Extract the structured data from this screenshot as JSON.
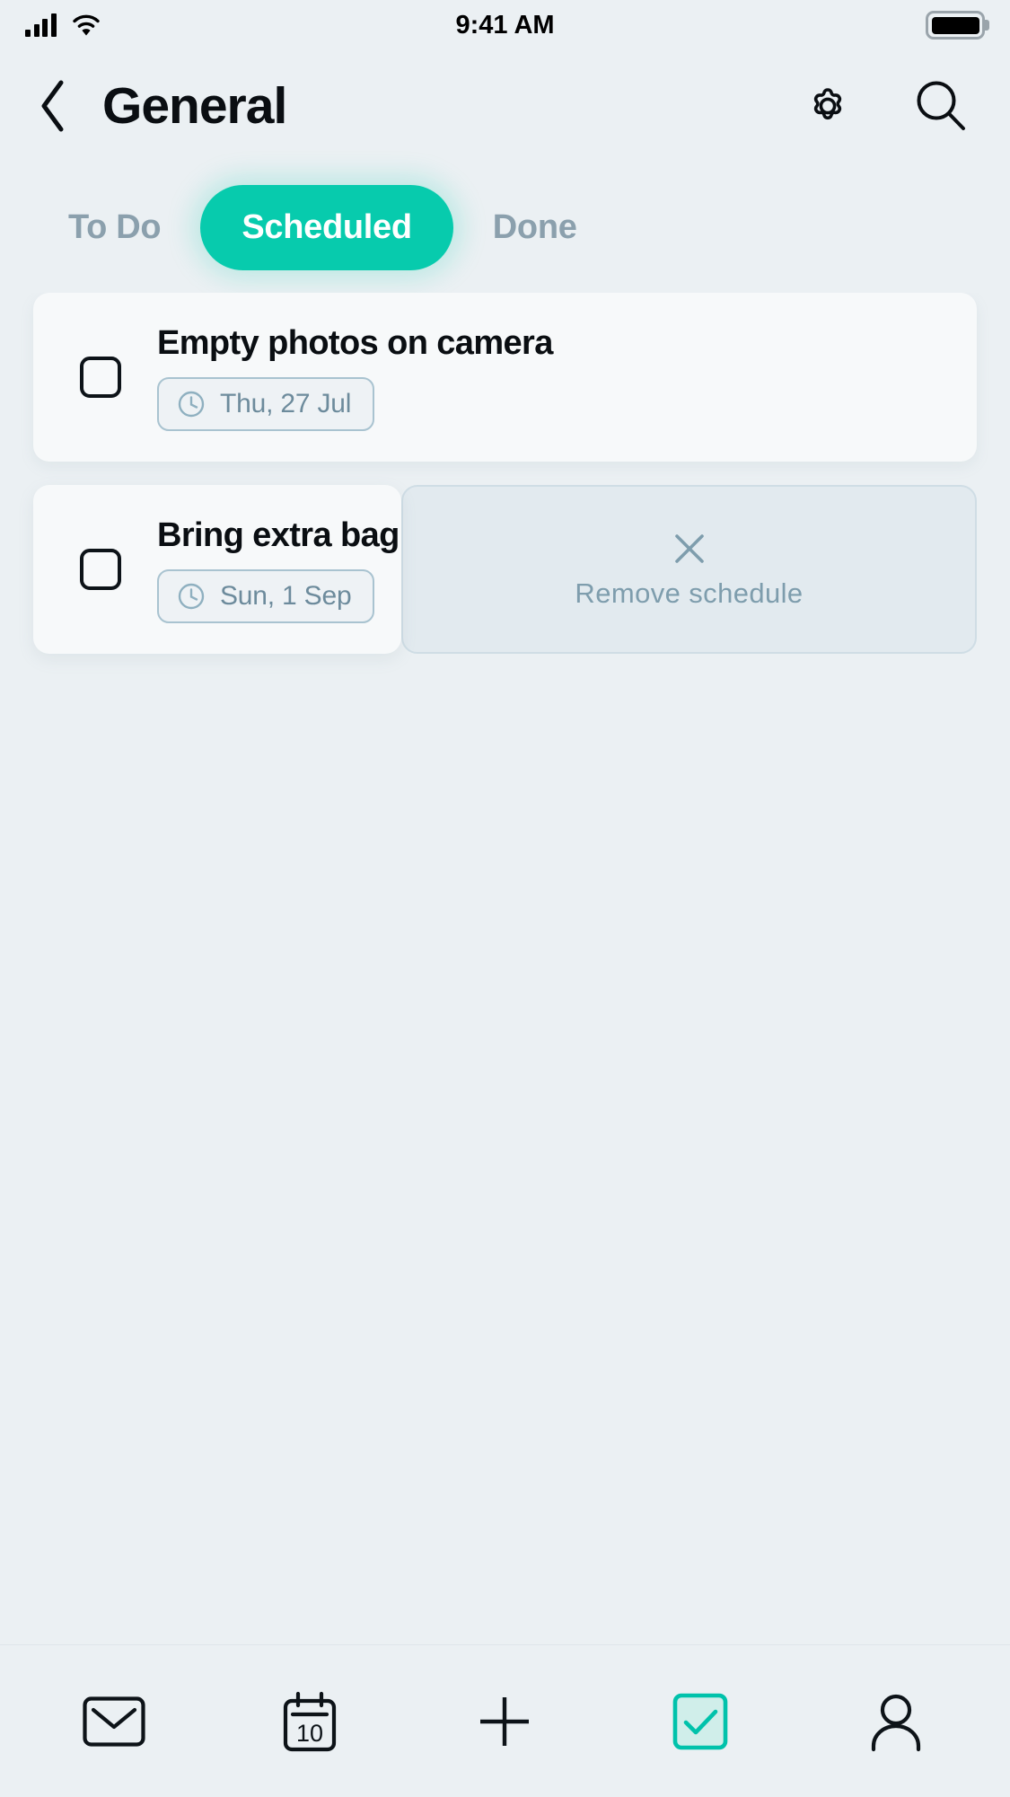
{
  "colors": {
    "page_bg": "#ebf0f3",
    "accent_teal": "#07cbad",
    "accent_teal_soft": "#d0eeea",
    "card_bg": "#f7f9fa",
    "muted_text": "#8ba0ad",
    "chip_border": "#a9c3d0",
    "chip_text": "#6d8b9c",
    "action_bg": "#e2eaef",
    "action_text": "#7e9dad",
    "title_text": "#0a0e12"
  },
  "status_bar": {
    "time": "9:41 AM",
    "signal_icon": "cellular-bars-icon",
    "wifi_icon": "wifi-icon",
    "battery_icon": "battery-full-icon",
    "signal_bars": 4,
    "battery_level": 100
  },
  "header": {
    "back_icon": "chevron-left-icon",
    "title": "General",
    "actions": [
      {
        "name": "settings-button",
        "icon": "gear-icon",
        "label": "Settings"
      },
      {
        "name": "search-button",
        "icon": "search-icon",
        "label": "Search"
      }
    ]
  },
  "tabs": {
    "selected": "Scheduled",
    "items": [
      {
        "label": "To Do",
        "active": false
      },
      {
        "label": "Scheduled",
        "active": true
      },
      {
        "label": "Done",
        "active": false
      }
    ]
  },
  "tasks": [
    {
      "title": "Empty photos on camera",
      "checked": false,
      "checkbox_icon": "unchecked-box-icon",
      "date_label": "Thu, 27 Jul",
      "date_icon": "clock-icon",
      "swiped": false
    },
    {
      "title": "Bring extra bag",
      "checked": false,
      "checkbox_icon": "unchecked-box-icon",
      "date_label": "Sun, 1 Sep",
      "date_icon": "clock-icon",
      "swiped": true,
      "swipe_action": {
        "label": "Remove schedule",
        "icon": "close-x-icon"
      }
    }
  ],
  "bottom_nav": {
    "active": "tasks",
    "items": [
      {
        "name": "nav-inbox",
        "icon": "envelope-icon",
        "label": "Inbox",
        "active": false
      },
      {
        "name": "nav-calendar",
        "icon": "calendar-10-icon",
        "label": "Calendar",
        "active": false,
        "badge": "10"
      },
      {
        "name": "nav-add",
        "icon": "plus-icon",
        "label": "Add",
        "active": false
      },
      {
        "name": "nav-tasks",
        "icon": "checked-box-icon",
        "label": "Tasks",
        "active": true
      },
      {
        "name": "nav-profile",
        "icon": "person-icon",
        "label": "Profile",
        "active": false
      }
    ]
  }
}
